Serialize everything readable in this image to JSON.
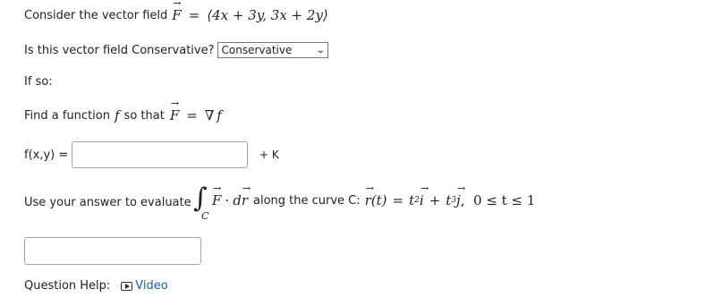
{
  "q1": {
    "prefix": "Consider the vector field",
    "F": "F",
    "eq": "=",
    "expr": "⟨4x + 3y, 3x + 2y⟩"
  },
  "q2": {
    "label": "Is this vector field Conservative?",
    "select_value": "Conservative"
  },
  "q3": {
    "label": "If so:"
  },
  "q4": {
    "prefix": "Find a function",
    "f": "f",
    "mid": "so that",
    "F": "F",
    "eq": "=",
    "grad": "∇",
    "gf": "f"
  },
  "q5": {
    "label": "f(x,y) =",
    "input_value": "",
    "suffix": "+ K"
  },
  "q6": {
    "prefix": "Use your answer to evaluate",
    "integral": "∫",
    "sub": "C",
    "F": "F",
    "dot": "·",
    "d": "d",
    "r": "r",
    "along": "along the curve C:",
    "rt": "r(t)",
    "eq": "=",
    "t2": "t",
    "e2": "2",
    "i": "i",
    "plus": "+",
    "t3": "t",
    "e3": "3",
    "j": "j",
    "range": ",  0 ≤ t ≤ 1"
  },
  "q7": {
    "input_value": ""
  },
  "help": {
    "label": "Question Help:",
    "video_icon": "play-icon",
    "video_label": "Video"
  },
  "colors": {
    "link": "#1f5fa8",
    "border": "#a6a6a6"
  }
}
